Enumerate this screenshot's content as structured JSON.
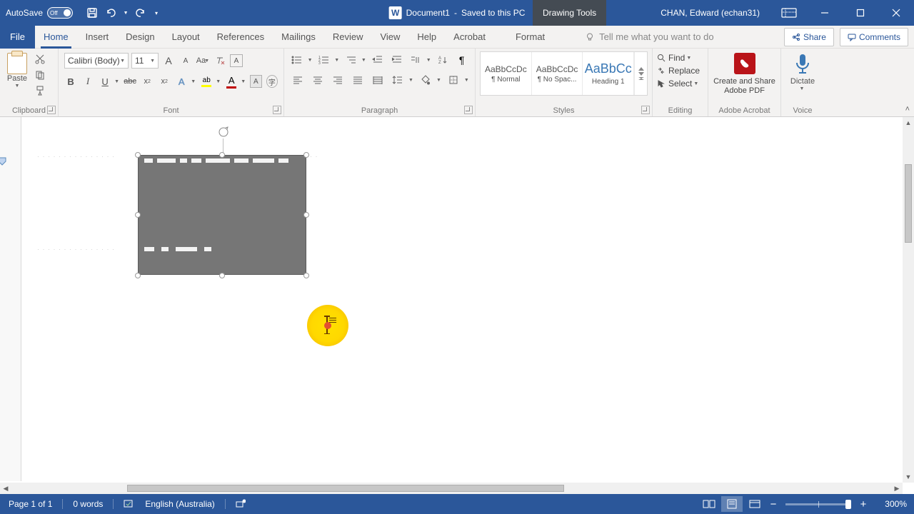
{
  "title_bar": {
    "autosave_label": "AutoSave",
    "autosave_state": "Off",
    "doc_title": "Document1",
    "save_state": "Saved to this PC",
    "context_tab": "Drawing Tools",
    "user_name": "CHAN, Edward (echan31)"
  },
  "menu": {
    "file": "File",
    "items": [
      "Home",
      "Insert",
      "Design",
      "Layout",
      "References",
      "Mailings",
      "Review",
      "View",
      "Help",
      "Acrobat"
    ],
    "context": "Format",
    "tell_me_placeholder": "Tell me what you want to do",
    "share": "Share",
    "comments": "Comments"
  },
  "ribbon": {
    "clipboard": {
      "label": "Clipboard",
      "paste": "Paste"
    },
    "font": {
      "label": "Font",
      "name": "Calibri (Body)",
      "size": "11",
      "inc_A": "A",
      "dec_A": "A",
      "change_case": "Aa",
      "bold": "B",
      "italic": "I",
      "underline": "U",
      "strike": "abc",
      "sub": "x",
      "sup": "x",
      "text_A": "A",
      "highlight_ab": "ab",
      "font_color_A": "A"
    },
    "paragraph": {
      "label": "Paragraph",
      "pilcrow": "¶"
    },
    "styles": {
      "label": "Styles",
      "items": [
        {
          "preview": "AaBbCcDc",
          "name": "¶ Normal"
        },
        {
          "preview": "AaBbCcDc",
          "name": "¶ No Spac..."
        },
        {
          "preview": "AaBbCc",
          "name": "Heading 1"
        }
      ]
    },
    "editing": {
      "label": "Editing",
      "find": "Find",
      "replace": "Replace",
      "select": "Select"
    },
    "adobe": {
      "label": "Adobe Acrobat",
      "icon_text": " ",
      "button": "Create and Share Adobe PDF"
    },
    "voice": {
      "label": "Voice",
      "button": "Dictate"
    }
  },
  "status": {
    "page": "Page 1 of 1",
    "words": "0 words",
    "language": "English (Australia)",
    "zoom": "300%"
  },
  "colors": {
    "highlight_bar": "#ffff00",
    "font_color_bar": "#c00000",
    "adobe_red": "#b91419"
  }
}
